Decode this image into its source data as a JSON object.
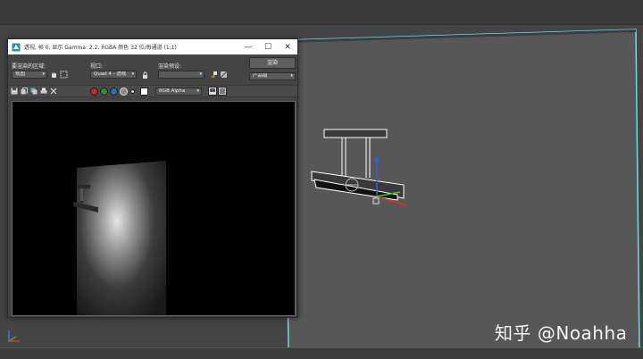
{
  "render_window": {
    "title": "透视, 帧 0, 显示 Gamma: 2.2, RGBA 颜色 32 位/每通道 (1:1)",
    "area_label": "要渲染的区域:",
    "area_value": "视图",
    "viewport_label": "视口:",
    "viewport_value": "Quad 4 - 透视",
    "preset_label": "渲染预设:",
    "preset_value": "",
    "render_button": "渲染",
    "product_value": "产品级",
    "channel_value": "RGB Alpha",
    "colors": {
      "red": "#c0262b",
      "green": "#2e8b3c",
      "blue": "#2f6fb0",
      "mono": "#cfcfcf",
      "swatch": "#ffffff"
    }
  },
  "window_controls": {
    "minimize": "—",
    "maximize": "☐",
    "close": "✕"
  },
  "watermark": "知乎 @Noahha",
  "icons": {
    "title": "app-icon",
    "save": "save-icon",
    "copy": "copy-icon",
    "clone": "clone-icon",
    "print": "print-icon",
    "clear": "clear-icon",
    "lock": "lock-icon",
    "axis": "axis-tripod-icon"
  },
  "accent": {
    "selection_outline": "#5fd1e0",
    "viewport_bg": "#444444"
  }
}
